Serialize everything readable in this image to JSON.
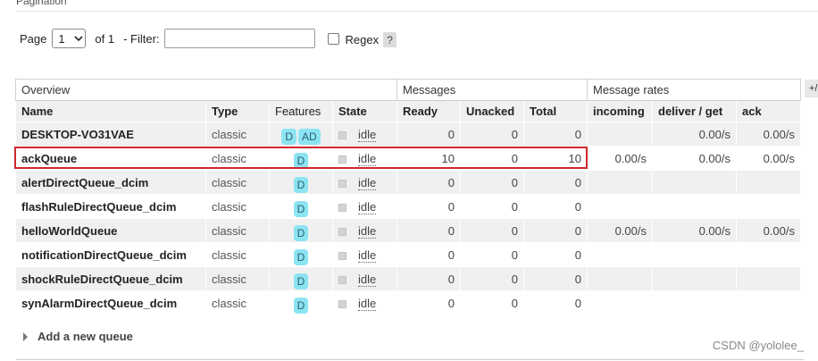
{
  "section": {
    "title": "Pagination"
  },
  "pagination": {
    "page_label": "Page",
    "page_value": "1",
    "of_text": "of 1",
    "filter_label": "- Filter:",
    "filter_value": "",
    "regex_label": "Regex",
    "help_label": "?"
  },
  "table": {
    "group_headers": [
      "Overview",
      "Messages",
      "Message rates"
    ],
    "columns": [
      "Name",
      "Type",
      "Features",
      "State",
      "Ready",
      "Unacked",
      "Total",
      "incoming",
      "deliver / get",
      "ack"
    ],
    "plus_label": "+/-",
    "rows": [
      {
        "name": "DESKTOP-VO31VAE",
        "type": "classic",
        "features": [
          "D",
          "AD"
        ],
        "state": "idle",
        "ready": "0",
        "unacked": "0",
        "total": "0",
        "incoming": "",
        "deliver": "0.00/s",
        "ack": "0.00/s"
      },
      {
        "name": "ackQueue",
        "type": "classic",
        "features": [
          "D"
        ],
        "state": "idle",
        "ready": "10",
        "unacked": "0",
        "total": "10",
        "incoming": "0.00/s",
        "deliver": "0.00/s",
        "ack": "0.00/s"
      },
      {
        "name": "alertDirectQueue_dcim",
        "type": "classic",
        "features": [
          "D"
        ],
        "state": "idle",
        "ready": "0",
        "unacked": "0",
        "total": "0",
        "incoming": "",
        "deliver": "",
        "ack": ""
      },
      {
        "name": "flashRuleDirectQueue_dcim",
        "type": "classic",
        "features": [
          "D"
        ],
        "state": "idle",
        "ready": "0",
        "unacked": "0",
        "total": "0",
        "incoming": "",
        "deliver": "",
        "ack": ""
      },
      {
        "name": "helloWorldQueue",
        "type": "classic",
        "features": [
          "D"
        ],
        "state": "idle",
        "ready": "0",
        "unacked": "0",
        "total": "0",
        "incoming": "0.00/s",
        "deliver": "0.00/s",
        "ack": "0.00/s"
      },
      {
        "name": "notificationDirectQueue_dcim",
        "type": "classic",
        "features": [
          "D"
        ],
        "state": "idle",
        "ready": "0",
        "unacked": "0",
        "total": "0",
        "incoming": "",
        "deliver": "",
        "ack": ""
      },
      {
        "name": "shockRuleDirectQueue_dcim",
        "type": "classic",
        "features": [
          "D"
        ],
        "state": "idle",
        "ready": "0",
        "unacked": "0",
        "total": "0",
        "incoming": "",
        "deliver": "",
        "ack": ""
      },
      {
        "name": "synAlarmDirectQueue_dcim",
        "type": "classic",
        "features": [
          "D"
        ],
        "state": "idle",
        "ready": "0",
        "unacked": "0",
        "total": "0",
        "incoming": "",
        "deliver": "",
        "ack": ""
      }
    ]
  },
  "add_queue": {
    "label": "Add a new queue"
  },
  "watermark": "CSDN @yololee_",
  "colors": {
    "highlight": "#d0282b",
    "feature_badge": "#8ce4f2"
  },
  "icons": {
    "select": "chevron-down-icon",
    "expander": "triangle-right-icon",
    "state": "state-square-icon"
  }
}
